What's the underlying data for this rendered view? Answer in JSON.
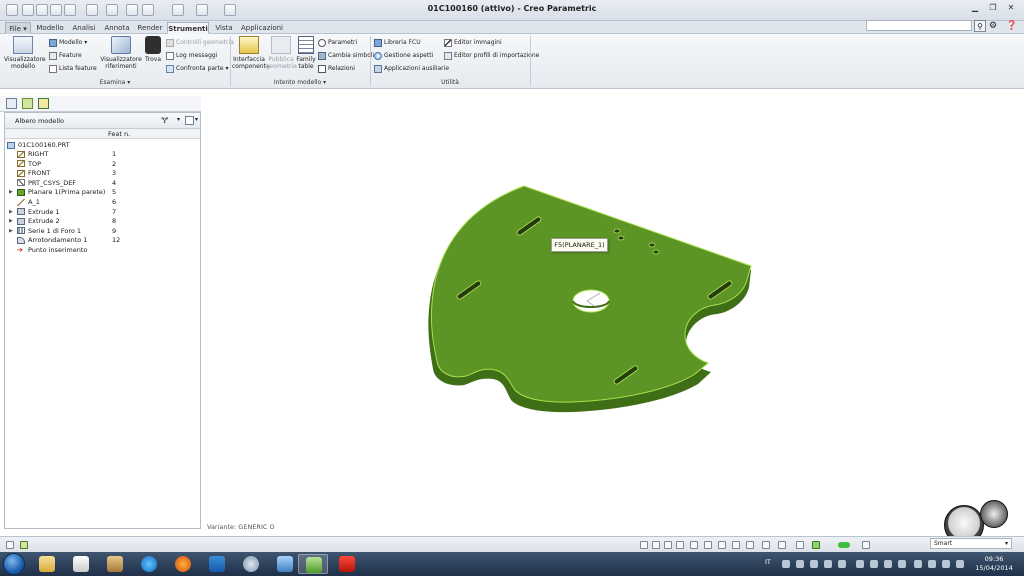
{
  "window": {
    "title": "01C100160 (attivo) - Creo Parametric"
  },
  "tabs": [
    {
      "label": "File",
      "kind": "file"
    },
    {
      "label": "Modello"
    },
    {
      "label": "Analisi"
    },
    {
      "label": "Annota"
    },
    {
      "label": "Render"
    },
    {
      "label": "Strumenti",
      "active": true
    },
    {
      "label": "Vista"
    },
    {
      "label": "Applicazioni"
    }
  ],
  "ribbon": {
    "esamina": {
      "label": "Esamina",
      "visualizzatore_modello": "Visualizzatore modello",
      "modello": "Modello",
      "feature": "Feature",
      "lista_feature": "Lista feature",
      "visualizzatore_riferimenti": "Visualizzatore riferimenti",
      "trova": "Trova",
      "controlli_geometria": "Controlli geometria",
      "log_messaggi": "Log messaggi",
      "confronta_parte": "Confronta parte"
    },
    "intento": {
      "label": "Intento modello",
      "interfaccia_componente": "Interfaccia componente",
      "pubblica_geometria": "Pubblica geometria",
      "family_table": "Family table",
      "parametri": "Parametri",
      "cambia_simboli": "Cambia simboli",
      "relazioni": "Relazioni"
    },
    "utilita": {
      "label": "Utilità",
      "libreria_fcu": "Libreria FCU",
      "gestione_aspetti": "Gestione aspetti",
      "applicazioni_ausiliarie": "Applicazioni ausiliarie",
      "editor_immagini": "Editor immagini",
      "editor_profili": "Editor profili di importazione"
    }
  },
  "tree": {
    "title": "Albero modello",
    "column": "Feat n.",
    "root": "01C100160.PRT",
    "items": [
      {
        "label": "RIGHT",
        "num": "1",
        "icon": "datum-plane-icon",
        "expandable": false
      },
      {
        "label": "TOP",
        "num": "2",
        "icon": "datum-plane-icon",
        "expandable": false
      },
      {
        "label": "FRONT",
        "num": "3",
        "icon": "datum-plane-icon",
        "expandable": false
      },
      {
        "label": "PRT_CSYS_DEF",
        "num": "4",
        "icon": "coordinate-system-icon",
        "expandable": false
      },
      {
        "label": "Planare 1(Prima parete)",
        "num": "5",
        "icon": "sheetmetal-wall-icon",
        "expandable": true
      },
      {
        "label": "A_1",
        "num": "6",
        "icon": "datum-axis-icon",
        "expandable": false
      },
      {
        "label": "Extrude 1",
        "num": "7",
        "icon": "extrude-icon",
        "expandable": true
      },
      {
        "label": "Extrude 2",
        "num": "8",
        "icon": "extrude-icon",
        "expandable": true
      },
      {
        "label": "Serie 1 di Foro 1",
        "num": "9",
        "icon": "pattern-icon",
        "expandable": true
      },
      {
        "label": "Arrotondamento 1",
        "num": "12",
        "icon": "round-icon",
        "expandable": false
      },
      {
        "label": "Punto inserimento",
        "num": "",
        "icon": "insert-arrow-icon",
        "expandable": false
      }
    ]
  },
  "viewport": {
    "tooltip": "F5(PLANARE_1)",
    "variant": "Variante: GENERIC O",
    "part_color": "#5c9426",
    "part_edge_color": "#aee34a"
  },
  "statusbar": {
    "filter": "Smart"
  },
  "taskbar": {
    "language": "IT",
    "time": "09:36",
    "date": "15/04/2014"
  }
}
